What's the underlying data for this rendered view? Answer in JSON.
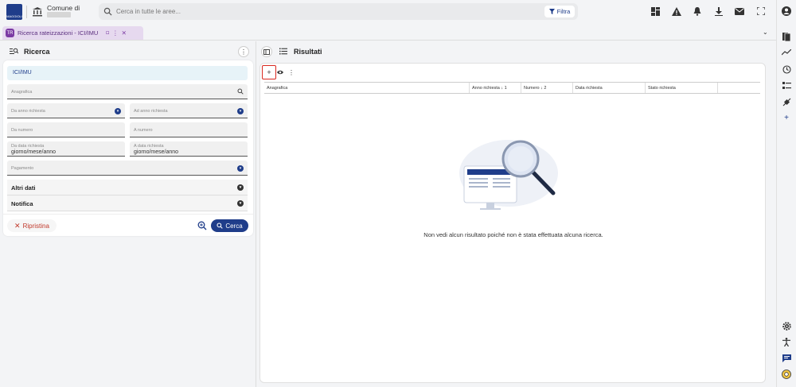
{
  "topbar": {
    "logo_text": "MAGGIOLI",
    "comune_label": "Comune di",
    "search_placeholder": "Cerca in tutte le aree...",
    "filter_label": "Filtra",
    "icons": [
      "dashboard-icon",
      "warning-icon",
      "bell-icon",
      "download-icon",
      "mail-icon",
      "fullscreen-icon"
    ]
  },
  "tabs": [
    {
      "label": "Ricerca rateizzazioni - ICI/IMU",
      "badge": "TR",
      "active": true
    }
  ],
  "left": {
    "title": "Ricerca",
    "tax_type": "ICI/IMU",
    "fields": {
      "anagrafica": "Anagrafica",
      "da_anno": "Da anno richiesta",
      "ad_anno": "Ad anno richiesta",
      "da_numero": "Da numero",
      "a_numero": "A numero",
      "da_data": "Da data richiesta",
      "a_data": "A data richiesta",
      "date_placeholder": "giorno/mese/anno",
      "pagamento": "Pagamento"
    },
    "sections": [
      "Altri dati",
      "Notifica"
    ],
    "reset_label": "Ripristina",
    "search_label": "Cerca"
  },
  "right": {
    "title": "Risultati",
    "columns": [
      {
        "label": "Anagrafica",
        "sort": ""
      },
      {
        "label": "Anno richiesta",
        "sort": "↓ 1"
      },
      {
        "label": "Numero",
        "sort": "↓ 2"
      },
      {
        "label": "Data richiesta",
        "sort": ""
      },
      {
        "label": "Stato richiesta",
        "sort": ""
      },
      {
        "label": "",
        "sort": ""
      }
    ],
    "empty_message": "Non vedi alcun risultato poiché non è stata effettuata alcuna ricerca."
  },
  "colors": {
    "primary": "#1f3d8a",
    "danger": "#d9281f",
    "tab_bg": "#e6d9ef",
    "tab_accent": "#7b3aa3"
  }
}
